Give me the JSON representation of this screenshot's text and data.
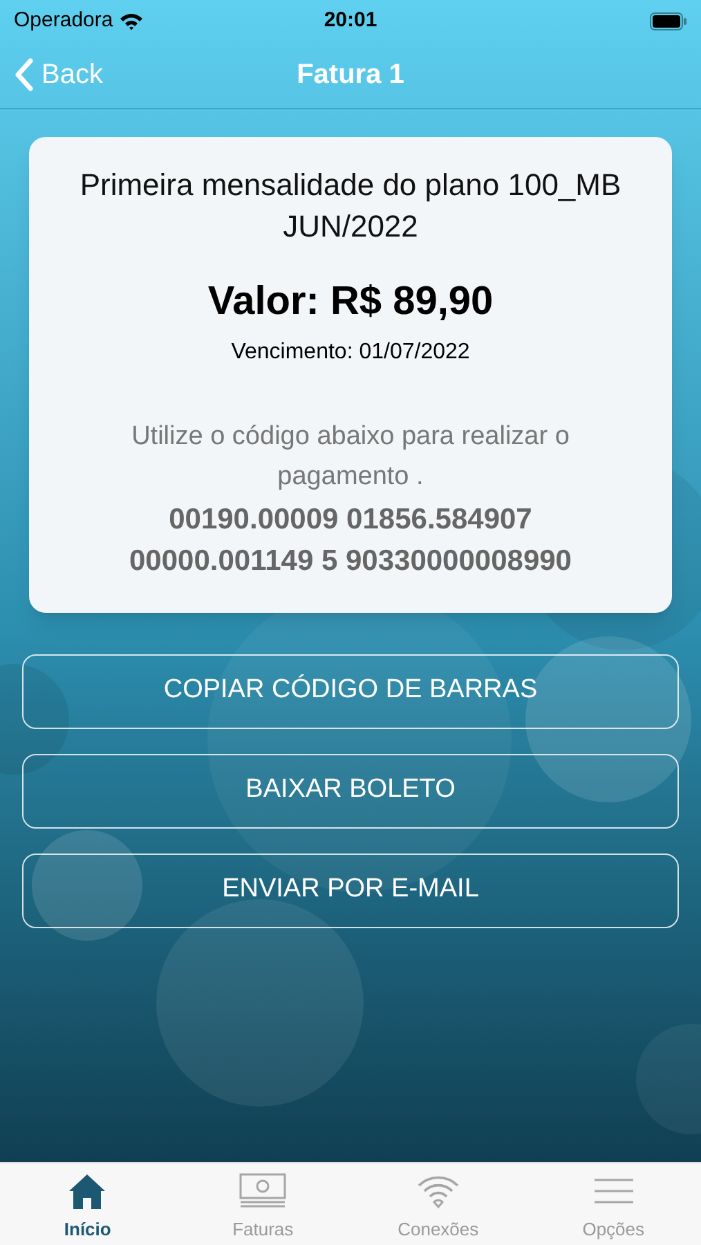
{
  "status_bar": {
    "carrier": "Operadora",
    "time": "20:01"
  },
  "nav": {
    "back": "Back",
    "title": "Fatura 1"
  },
  "invoice": {
    "title_lines": [
      "Primeira mensalidade do plano 100_MB",
      "JUN/2022"
    ],
    "amount": "Valor: R$ 89,90",
    "due": "Vencimento: 01/07/2022",
    "instruction": "Utilize o código abaixo para realizar o pagamento .",
    "code_lines": [
      "00190.00009 01856.584907",
      "00000.001149 5 90330000008990"
    ]
  },
  "buttons": [
    "COPIAR CÓDIGO DE BARRAS",
    "BAIXAR BOLETO",
    "ENVIAR POR E-MAIL"
  ],
  "tabs": [
    {
      "label": "Início",
      "kind": "home",
      "selected": true
    },
    {
      "label": "Faturas",
      "kind": "money",
      "selected": false
    },
    {
      "label": "Conexões",
      "kind": "wifi",
      "selected": false
    },
    {
      "label": "Opções",
      "kind": "menu",
      "selected": false
    }
  ]
}
